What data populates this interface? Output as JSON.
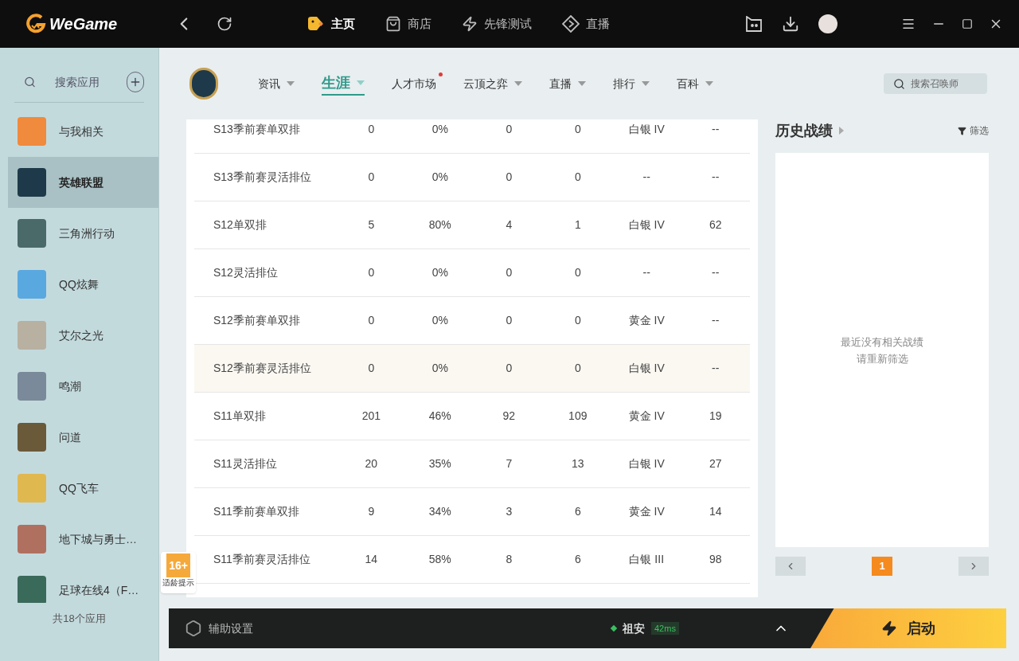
{
  "brand": "WeGame",
  "top_tabs": [
    {
      "label": "主页",
      "selected": true,
      "kind": "home"
    },
    {
      "label": "商店",
      "selected": false,
      "kind": "store"
    },
    {
      "label": "先锋测试",
      "selected": false,
      "kind": "test"
    },
    {
      "label": "直播",
      "selected": false,
      "kind": "live"
    }
  ],
  "sidebar": {
    "search_placeholder": "搜索应用",
    "items": [
      {
        "label": "与我相关",
        "selected": false,
        "color": "#f08a3c"
      },
      {
        "label": "英雄联盟",
        "selected": true,
        "color": "#1e3a4a"
      },
      {
        "label": "三角洲行动",
        "selected": false,
        "color": "#4a6a6a"
      },
      {
        "label": "QQ炫舞",
        "selected": false,
        "color": "#5aa8e0"
      },
      {
        "label": "艾尔之光",
        "selected": false,
        "color": "#b8b0a0"
      },
      {
        "label": "鸣潮",
        "selected": false,
        "color": "#7a8a9a"
      },
      {
        "label": "问道",
        "selected": false,
        "color": "#6a5a3a"
      },
      {
        "label": "QQ飞车",
        "selected": false,
        "color": "#e0b850"
      },
      {
        "label": "地下城与勇士…",
        "selected": false,
        "color": "#b07060"
      },
      {
        "label": "足球在线4（F…",
        "selected": false,
        "color": "#3a6a5a"
      }
    ],
    "footer": "共18个应用"
  },
  "game_nav": [
    {
      "label": "资讯",
      "selected": false,
      "menu": true,
      "dot": false
    },
    {
      "label": "生涯",
      "selected": true,
      "menu": true,
      "dot": false
    },
    {
      "label": "人才市场",
      "selected": false,
      "menu": false,
      "dot": true
    },
    {
      "label": "云顶之弈",
      "selected": false,
      "menu": true,
      "dot": false
    },
    {
      "label": "直播",
      "selected": false,
      "menu": true,
      "dot": false
    },
    {
      "label": "排行",
      "selected": false,
      "menu": true,
      "dot": false
    },
    {
      "label": "百科",
      "selected": false,
      "menu": true,
      "dot": false
    }
  ],
  "summoner_search": {
    "placeholder": "搜索召唤师"
  },
  "table": {
    "rows": [
      {
        "selected": false,
        "cells": [
          "S13季前赛单双排",
          "0",
          "0%",
          "0",
          "0",
          "白银 IV",
          "--"
        ]
      },
      {
        "selected": false,
        "cells": [
          "S13季前赛灵活排位",
          "0",
          "0%",
          "0",
          "0",
          "--",
          "--"
        ]
      },
      {
        "selected": false,
        "cells": [
          "S12单双排",
          "5",
          "80%",
          "4",
          "1",
          "白银 IV",
          "62"
        ]
      },
      {
        "selected": false,
        "cells": [
          "S12灵活排位",
          "0",
          "0%",
          "0",
          "0",
          "--",
          "--"
        ]
      },
      {
        "selected": false,
        "cells": [
          "S12季前赛单双排",
          "0",
          "0%",
          "0",
          "0",
          "黄金 IV",
          "--"
        ]
      },
      {
        "selected": true,
        "cells": [
          "S12季前赛灵活排位",
          "0",
          "0%",
          "0",
          "0",
          "白银 IV",
          "--"
        ]
      },
      {
        "selected": false,
        "cells": [
          "S11单双排",
          "201",
          "46%",
          "92",
          "109",
          "黄金 IV",
          "19"
        ]
      },
      {
        "selected": false,
        "cells": [
          "S11灵活排位",
          "20",
          "35%",
          "7",
          "13",
          "白银 IV",
          "27"
        ]
      },
      {
        "selected": false,
        "cells": [
          "S11季前赛单双排",
          "9",
          "34%",
          "3",
          "6",
          "黄金 IV",
          "14"
        ]
      },
      {
        "selected": false,
        "cells": [
          "S11季前赛灵活排位",
          "14",
          "58%",
          "8",
          "6",
          "白银 III",
          "98"
        ]
      }
    ]
  },
  "history": {
    "title": "历史战绩",
    "filter": "筛选",
    "empty_lines": [
      "最近没有相关战绩",
      "请重新筛选"
    ],
    "pages": [
      {
        "label": "1",
        "selected": true
      }
    ]
  },
  "age_badge": {
    "rating": "16+",
    "caption": "适龄提示"
  },
  "bottom_bar": {
    "settings": "辅助设置",
    "region": "祖安",
    "ping": "42ms",
    "launch": "启动"
  }
}
